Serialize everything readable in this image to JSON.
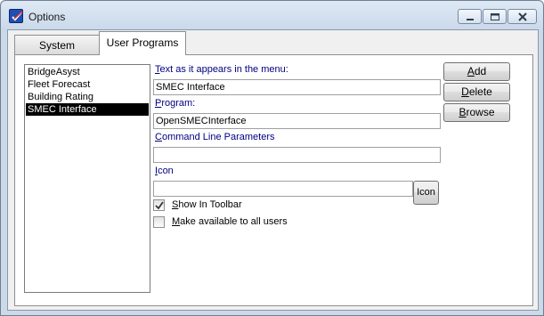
{
  "window": {
    "title": "Options"
  },
  "tabs": [
    {
      "label": "System",
      "active": false
    },
    {
      "label": "User Programs",
      "active": true
    }
  ],
  "program_list": [
    {
      "label": "BridgeAsyst",
      "selected": false
    },
    {
      "label": "Fleet Forecast",
      "selected": false
    },
    {
      "label": "Building Rating",
      "selected": false
    },
    {
      "label": "SMEC Interface",
      "selected": true
    }
  ],
  "form": {
    "menu_text_label_key": "T",
    "menu_text_label_rest": "ext as it appears in the menu:",
    "menu_text_value": "SMEC Interface",
    "program_label_key": "P",
    "program_label_rest": "rogram:",
    "program_value": "OpenSMECInterface",
    "cmd_label_key": "C",
    "cmd_label_rest": "ommand Line Parameters",
    "cmd_value": "",
    "icon_label_key": "I",
    "icon_label_rest": "con",
    "icon_value": "",
    "icon_button": "Icon",
    "show_toolbar_key": "S",
    "show_toolbar_rest": "how In Toolbar",
    "show_toolbar_checked": true,
    "all_users_key": "M",
    "all_users_rest": "ake available to all users",
    "all_users_checked": false
  },
  "buttons": {
    "add_key": "A",
    "add_rest": "dd",
    "delete_key": "D",
    "delete_rest": "elete",
    "browse_key": "B",
    "browse_rest": "rowse"
  },
  "colors": {
    "label_color": "#000080",
    "selection_bg": "#000000",
    "titlebar": "#c9d8ea"
  },
  "icons": {
    "app": "checkmark-app-icon",
    "minimize": "minimize-icon",
    "maximize": "maximize-icon",
    "close": "close-icon",
    "checkbox_mark": "check-icon"
  }
}
